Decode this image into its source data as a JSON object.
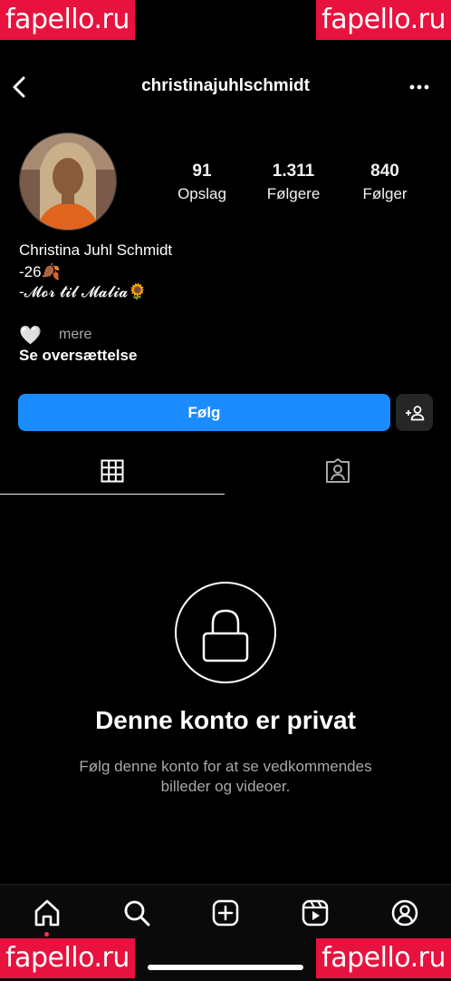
{
  "watermarks": {
    "top_left": "fapello.ru",
    "top_right": "fapello.ru",
    "bottom_left": "fapello.ru",
    "bottom_right": "fapello.ru"
  },
  "header": {
    "username": "christinajuhlschmidt",
    "back_icon": "chevron-left-icon",
    "menu_icon": "more-horizontal-icon"
  },
  "stats": [
    {
      "value": "91",
      "label": "Opslag"
    },
    {
      "value": "1.311",
      "label": "Følgere"
    },
    {
      "value": "840",
      "label": "Følger"
    }
  ],
  "profile": {
    "full_name": "Christina Juhl Schmidt",
    "bio_line1": "-26🍂",
    "bio_line2": "-𝓜𝓸𝓻 𝓽𝓲𝓵 𝓜𝓪𝓵𝓲𝓪🌻",
    "heart": "🤍",
    "more": "mere",
    "translate": "Se oversættelse"
  },
  "actions": {
    "follow_label": "Følg",
    "add_person_icon": "add-person-icon"
  },
  "tabs": [
    {
      "icon": "grid-icon",
      "active": true
    },
    {
      "icon": "tagged-icon",
      "active": false
    }
  ],
  "private": {
    "title": "Denne konto er privat",
    "line1": "Følg denne konto for at se vedkommendes",
    "line2": "billeder og videoer."
  },
  "nav": [
    "home-icon",
    "search-icon",
    "create-icon",
    "reels-icon",
    "profile-icon"
  ],
  "colors": {
    "accent": "#1a8cff",
    "watermark": "#e8123f",
    "background": "#000000"
  }
}
